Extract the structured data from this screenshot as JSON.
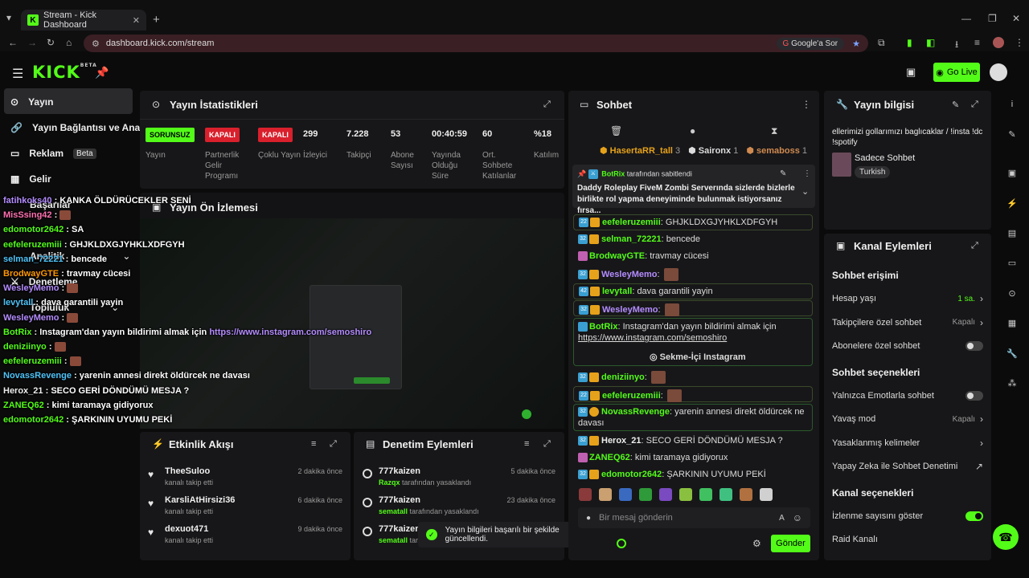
{
  "browser": {
    "tab_title": "Stream - Kick Dashboard",
    "url": "dashboard.kick.com/stream",
    "google_btn": "Google'a Sor"
  },
  "app": {
    "logo": "KICK",
    "beta": "BETA",
    "go_live": "Go Live"
  },
  "sidebar": {
    "items": [
      {
        "label": "Yayın"
      },
      {
        "label": "Yayın Bağlantısı ve Anahtar"
      },
      {
        "label": "Reklam",
        "badge": "Beta"
      },
      {
        "label": "Gelir"
      },
      {
        "label": "Başarılar"
      },
      {
        "label": "Analitik"
      },
      {
        "label": "Denetleme"
      },
      {
        "label": "Topluluk"
      }
    ]
  },
  "stats": {
    "title": "Yayın İstatistikleri",
    "cols": [
      {
        "value": "SORUNSUZ",
        "label": "Yayın",
        "kind": "on"
      },
      {
        "value": "KAPALI",
        "label": "Partnerlik Gelir Programı",
        "kind": "off"
      },
      {
        "value": "KAPALI",
        "label": "Çoklu Yayın",
        "kind": "off"
      },
      {
        "value": "299",
        "label": "İzleyici"
      },
      {
        "value": "7.228",
        "label": "Takipçi"
      },
      {
        "value": "53",
        "label": "Abone Sayısı"
      },
      {
        "value": "00:40:59",
        "label": "Yayında Olduğu Süre"
      },
      {
        "value": "60",
        "label": "Ort. Sohbete Katılanlar"
      },
      {
        "value": "%18",
        "label": "Katılım"
      }
    ]
  },
  "preview": {
    "title": "Yayın Ön İzlemesi"
  },
  "overlay_chat": [
    {
      "user": "fatihkoks40",
      "msg": "KANKA ÖLDÜRÜCEKLER SENİ",
      "color": "#b48cff"
    },
    {
      "user": "MisSsing42",
      "msg": "",
      "color": "#ff70b0"
    },
    {
      "user": "edomotor2642",
      "msg": "SA",
      "color": "#53fc18"
    },
    {
      "user": "eefeleruzemiii",
      "msg": "GHJKLDXGJYHKLXDFGYH",
      "color": "#53fc18"
    },
    {
      "user": "selman_72221",
      "msg": "bencede",
      "color": "#4fc3f7"
    },
    {
      "user": "BrodwayGTE",
      "msg": "travmay cücesi",
      "color": "#ff9800"
    },
    {
      "user": "WesleyMemo",
      "msg": "",
      "color": "#b48cff"
    },
    {
      "user": "levytall",
      "msg": "dava garantili yayin",
      "color": "#4fc3f7"
    },
    {
      "user": "WesleyMemo",
      "msg": "",
      "color": "#b48cff"
    },
    {
      "user": "BotRix",
      "msg": "Instagram'dan yayın bildirimi almak için ",
      "link": "https://www.instagram.com/semoshiro",
      "color": "#53fc18"
    },
    {
      "user": "deniziinyo",
      "msg": "",
      "color": "#53fc18"
    },
    {
      "user": "eefeleruzemiii",
      "msg": "",
      "color": "#53fc18"
    },
    {
      "user": "NovassRevenge",
      "msg": "yarenin annesi direkt öldürcek ne davası",
      "color": "#4fc3f7"
    },
    {
      "user": "Herox_21",
      "msg": "SECO GERİ DÖNDÜMÜ MESJA ?",
      "color": "#eeeeee"
    },
    {
      "user": "ZANEQ62",
      "msg": "kimi taramaya gidiyorux",
      "color": "#53fc18"
    },
    {
      "user": "edomotor2642",
      "msg": "ŞARKININ UYUMU PEKİ",
      "color": "#53fc18"
    }
  ],
  "activity": {
    "title": "Etkinlik Akışı",
    "items": [
      {
        "user": "TheeSuloo",
        "action": "kanalı takip etti",
        "time": "2 dakika önce"
      },
      {
        "user": "KarsliAtHirsizi36",
        "action": "kanalı takip etti",
        "time": "6 dakika önce"
      },
      {
        "user": "dexuot471",
        "action": "kanalı takip etti",
        "time": "9 dakika önce"
      }
    ]
  },
  "moderation": {
    "title": "Denetim Eylemleri",
    "items": [
      {
        "user": "777kaizen",
        "mod": "Razqx",
        "action": "tarafından yasaklandı",
        "time": "5 dakika önce"
      },
      {
        "user": "777kaizen",
        "mod": "sematall",
        "action": "tarafından yasaklandı",
        "time": "23 dakika önce"
      },
      {
        "user": "777kaizen",
        "mod": "sematall",
        "action": "tarafından yas",
        "time": ""
      }
    ]
  },
  "toast": {
    "text": "Yayın bilgileri başarılı bir şekilde güncellendi."
  },
  "chat": {
    "title": "Sohbet",
    "top_gifters": [
      {
        "name": "HasertaRR_tall",
        "count": "3"
      },
      {
        "name": "Saironx",
        "count": "1"
      },
      {
        "name": "semaboss",
        "count": "1"
      }
    ],
    "pinned": {
      "by": "BotRix",
      "by_suffix": "tarafından sabitlendi",
      "text": "Daddy Roleplay FiveM Zombi Serverında sizlerde bizlerle birlikte rol yapma deneyiminde bulunmak istiyorsanız fırsa..."
    },
    "messages": [
      {
        "user": "eefeleruzemiii",
        "msg": "GHJKLDXGJYHKLXDFGYH",
        "color": "#53fc18",
        "badge": "22"
      },
      {
        "user": "selman_72221",
        "msg": "bencede",
        "color": "#53fc18",
        "badge": "32"
      },
      {
        "user": "BrodwayGTE",
        "msg": "travmay cücesi",
        "color": "#53fc18",
        "badge": ""
      },
      {
        "user": "WesleyMemo",
        "msg": "",
        "color": "#b48cff",
        "badge": "32"
      },
      {
        "user": "levytall",
        "msg": "dava garantili yayin",
        "color": "#53fc18",
        "badge": "42"
      },
      {
        "user": "WesleyMemo",
        "msg": "",
        "color": "#b48cff",
        "badge": "32"
      }
    ],
    "botrix": {
      "user": "BotRix",
      "msg": "Instagram'dan yayın bildirimi almak için",
      "link": "https://www.instagram.com/semoshiro",
      "button": "Sekme-İçi Instagram"
    },
    "messages2": [
      {
        "user": "deniziinyo",
        "msg": "",
        "color": "#53fc18",
        "badge": "32"
      },
      {
        "user": "eefeleruzemiii",
        "msg": "",
        "color": "#53fc18",
        "badge": "22"
      }
    ],
    "novass": {
      "user": "NovassRevenge",
      "msg": "yarenin annesi direkt öldürcek ne davası",
      "badge": "32"
    },
    "messages3": [
      {
        "user": "Herox_21",
        "msg": "SECO GERİ DÖNDÜMÜ MESJA ?",
        "color": "#eeeeee",
        "badge": "32"
      },
      {
        "user": "ZANEQ62",
        "msg": "kimi taramaya gidiyorux",
        "color": "#53fc18",
        "badge": ""
      },
      {
        "user": "edomotor2642",
        "msg": "ŞARKININ UYUMU PEKİ",
        "color": "#53fc18",
        "badge": "32"
      }
    ],
    "input_placeholder": "Bir mesaj gönderin",
    "send": "Gönder"
  },
  "info": {
    "title": "Yayın bilgisi",
    "stream_title": "ellerimizi gollarımızı baglıcaklar / !insta !dc !spotify",
    "category": "Sadece Sohbet",
    "tag": "Turkish"
  },
  "channel": {
    "title": "Kanal Eylemleri",
    "sections": [
      {
        "heading": "Sohbet erişimi",
        "rows": [
          {
            "label": "Hesap yaşı",
            "value": "1 sa.",
            "kind": "link-green"
          },
          {
            "label": "Takipçilere özel sohbet",
            "value": "Kapalı",
            "kind": "link"
          },
          {
            "label": "Abonelere özel sohbet",
            "value": "",
            "kind": "toggle-off"
          }
        ]
      },
      {
        "heading": "Sohbet seçenekleri",
        "rows": [
          {
            "label": "Yalnızca Emotlarla sohbet",
            "value": "",
            "kind": "toggle-off"
          },
          {
            "label": "Yavaş mod",
            "value": "Kapalı",
            "kind": "link"
          },
          {
            "label": "Yasaklanmış kelimeler",
            "value": "",
            "kind": "link"
          },
          {
            "label": "Yapay Zeka ile Sohbet Denetimi",
            "value": "",
            "kind": "ext"
          }
        ]
      },
      {
        "heading": "Kanal seçenekleri",
        "rows": [
          {
            "label": "İzlenme sayısını göster",
            "value": "",
            "kind": "toggle-on"
          },
          {
            "label": "Raid Kanalı",
            "value": "",
            "kind": "none"
          }
        ]
      }
    ]
  }
}
